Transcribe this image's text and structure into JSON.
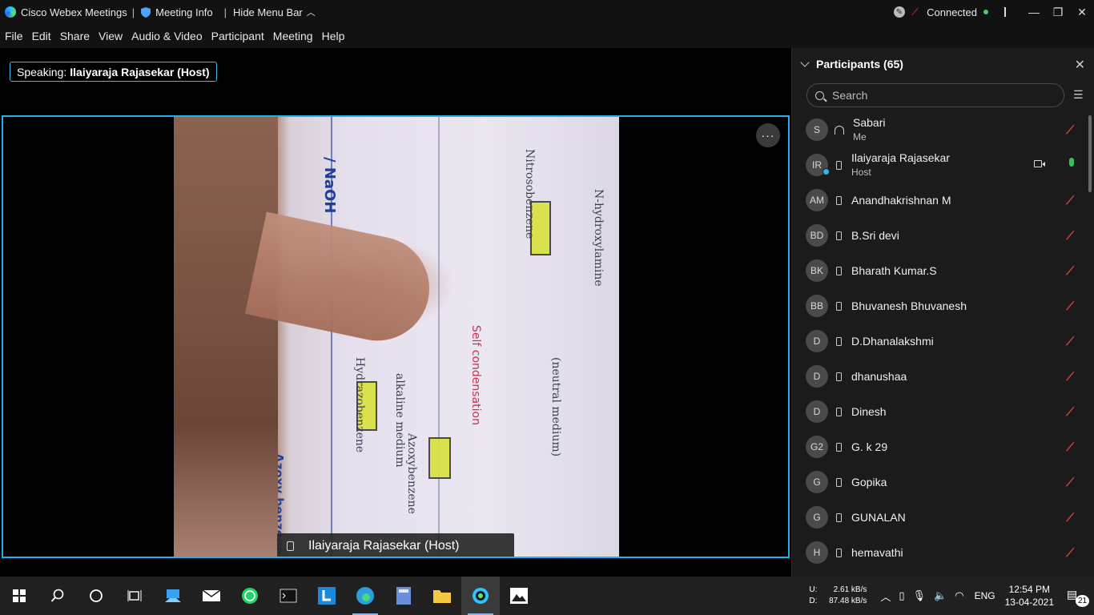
{
  "titlebar": {
    "app_name": "Cisco Webex Meetings",
    "meeting_info": "Meeting Info",
    "hide_menu": "Hide Menu Bar",
    "status": "Connected",
    "colors": {
      "connected_dot": "#3ed164",
      "mute_red": "#e0453a"
    }
  },
  "menu": {
    "file": "File",
    "edit": "Edit",
    "share": "Share",
    "view": "View",
    "audio_video": "Audio & Video",
    "participant": "Participant",
    "meeting": "Meeting",
    "help": "Help"
  },
  "speaking": {
    "label": "Speaking:",
    "name": "Ilaiyaraja Rajasekar (Host)"
  },
  "video": {
    "name_tag": "Ilaiyaraja Rajasekar  (Host)",
    "more_label": "···",
    "frame_color": "#1fb2ea",
    "board_text": {
      "nitrosobenzene": "Nitrosobenzene",
      "hydroxylamine": "N-hydroxylamine",
      "self_condensation": "Self condensation",
      "alkaline_medium": "alkaline medium",
      "hydrazobenzene": "Hydrazobenzene",
      "azoxybenzene": "Azoxybenzene",
      "neutral_medium": "(neutral medium)",
      "naoh": "/ NaOH",
      "azoxy": "Azoxy benzene"
    }
  },
  "participants": {
    "title": "Participants (65)",
    "search_placeholder": "Search",
    "list": [
      {
        "initials": "S",
        "name": "Sabari",
        "role": "Me",
        "device": "headset-icon",
        "muted": true,
        "camera": false
      },
      {
        "initials": "IR",
        "name": "Ilaiyaraja Rajasekar",
        "role": "Host",
        "device": "phone-icon",
        "muted": false,
        "camera": true,
        "badge": true
      },
      {
        "initials": "AM",
        "name": "Anandhakrishnan M",
        "role": "",
        "device": "phone-icon",
        "muted": true
      },
      {
        "initials": "BD",
        "name": "B.Sri devi",
        "role": "",
        "device": "phone-icon",
        "muted": true
      },
      {
        "initials": "BK",
        "name": "Bharath Kumar.S",
        "role": "",
        "device": "phone-icon",
        "muted": true
      },
      {
        "initials": "BB",
        "name": "Bhuvanesh Bhuvanesh",
        "role": "",
        "device": "phone-icon",
        "muted": true
      },
      {
        "initials": "D",
        "name": "D.Dhanalakshmi",
        "role": "",
        "device": "phone-icon",
        "muted": true
      },
      {
        "initials": "D",
        "name": "dhanushaa",
        "role": "",
        "device": "phone-icon",
        "muted": true
      },
      {
        "initials": "D",
        "name": "Dinesh",
        "role": "",
        "device": "phone-icon",
        "muted": true
      },
      {
        "initials": "G2",
        "name": "G. k 29",
        "role": "",
        "device": "phone-icon",
        "muted": true
      },
      {
        "initials": "G",
        "name": "Gopika",
        "role": "",
        "device": "phone-icon",
        "muted": true
      },
      {
        "initials": "G",
        "name": "GUNALAN",
        "role": "",
        "device": "phone-icon",
        "muted": true
      },
      {
        "initials": "H",
        "name": "hemavathi",
        "role": "",
        "device": "phone-icon",
        "muted": true
      }
    ]
  },
  "taskbar": {
    "net_upload_label": "U:",
    "net_upload": "2.61 kB/s",
    "net_download_label": "D:",
    "net_download": "87.48 kB/s",
    "language": "ENG",
    "time": "12:54 PM",
    "date": "13-04-2021",
    "notification_count": "21"
  }
}
